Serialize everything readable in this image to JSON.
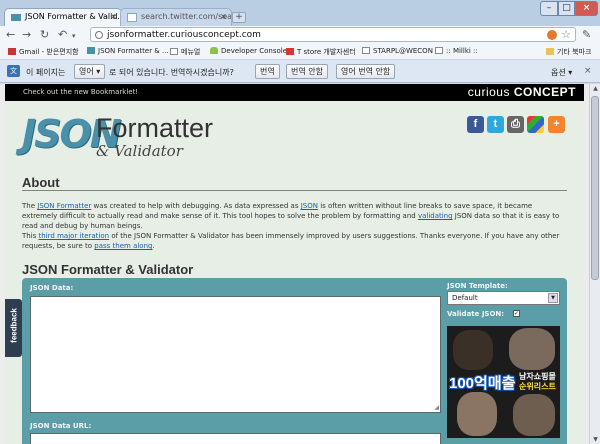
{
  "browser": {
    "tabs": [
      {
        "title": "JSON Formatter & Valid..."
      },
      {
        "title": "search.twitter.com/searc..."
      }
    ],
    "new_tab_icon": "plus-icon",
    "window_controls": [
      "minimize",
      "maximize",
      "close"
    ],
    "address": "jsonformatter.curiousconcept.com",
    "bookmarks": [
      {
        "label": "Gmail - 받은편지함"
      },
      {
        "label": "JSON Formatter & ..."
      },
      {
        "label": "메뉴얼"
      },
      {
        "label": "Developer Console"
      },
      {
        "label": "T store 개발자센터"
      },
      {
        "label": "STARPL@WECON"
      },
      {
        "label": ":: Millki ::"
      },
      {
        "label": "기타 북마크"
      }
    ],
    "translate_bar": {
      "prefix": "이 페이지는",
      "language": "영어",
      "middle": "로 되어 있습니다. 번역하시겠습니까?",
      "translate_btn": "번역",
      "no_translate_btn": "번역 안함",
      "never_btn": "영어 번역 안함",
      "options": "옵션"
    }
  },
  "page": {
    "topbar_link": "Check out the new Bookmarklet!",
    "brand_light": "curious",
    "brand_bold": "CONCEPT",
    "logo": {
      "json": "JSON",
      "formatter": "Formatter",
      "validator": "& Validator"
    },
    "about": {
      "heading": "About",
      "p1_a": "The ",
      "p1_link1": "JSON Formatter",
      "p1_b": " was created to help with debugging. As data expressed as ",
      "p1_link2": "JSON",
      "p1_c": " is often written without line breaks to save space, it became extremely difficult to actually read and make sense of it. This tool hopes to solve the problem by formatting and ",
      "p1_link3": "validating",
      "p1_d": " JSON data so that it is easy to read and debug by human beings.",
      "p2_a": "This ",
      "p2_link1": "third major iteration",
      "p2_b": " of the JSON Formatter & Validator has been immensely improved by users suggestions. Thanks everyone. If you have any other requests, be sure to ",
      "p2_link2": "pass them along",
      "p2_c": "."
    },
    "tool": {
      "heading": "JSON Formatter & Validator",
      "json_data_label": "JSON Data:",
      "json_template_label": "JSON Template:",
      "template_value": "Default",
      "validate_label": "Validate JSON:",
      "validate_mark": "✓",
      "url_label": "JSON Data URL:"
    },
    "feedback": "feedback",
    "ad": {
      "main": "100억매출",
      "sub1": "남자쇼핑몰",
      "sub2": "순위리스트"
    }
  },
  "colors": {
    "panel": "#5b9ea8",
    "link": "#1a5fa8",
    "json_logo": "#4a90a8"
  }
}
